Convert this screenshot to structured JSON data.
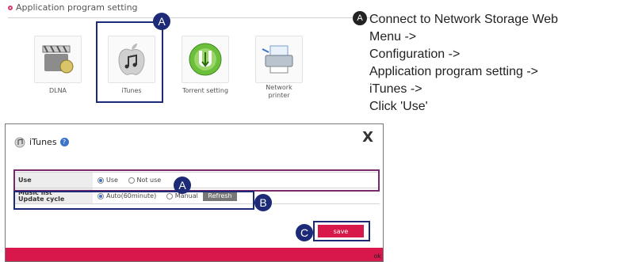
{
  "section": {
    "title": "Application program setting"
  },
  "apps": [
    {
      "name": "dlna",
      "label": "DLNA"
    },
    {
      "name": "itunes",
      "label": "iTunes"
    },
    {
      "name": "torrent",
      "label": "Torrent setting"
    },
    {
      "name": "network-printer",
      "label": "Network\nprinter"
    }
  ],
  "badges": {
    "a": "A",
    "b": "B",
    "c": "C"
  },
  "instructions": {
    "badge": "A",
    "lines": [
      "Connect to Network Storage Web",
      "Menu ->",
      "Configuration ->",
      "Application program setting ->",
      "iTunes ->",
      "Click 'Use'"
    ]
  },
  "dialog": {
    "title": "iTunes",
    "help": "?",
    "close": "X",
    "rows": {
      "use": {
        "label": "Use",
        "opt_use": "Use",
        "opt_not_use": "Not use"
      },
      "update": {
        "label": "Music list\nUpdate cycle",
        "opt_auto": "Auto(60minute)",
        "opt_manual": "Manual",
        "refresh": "Refresh"
      }
    },
    "save": "save",
    "footer_tail": "ok"
  },
  "colors": {
    "accent": "#d8184b",
    "highlight": "#1c2a78"
  }
}
